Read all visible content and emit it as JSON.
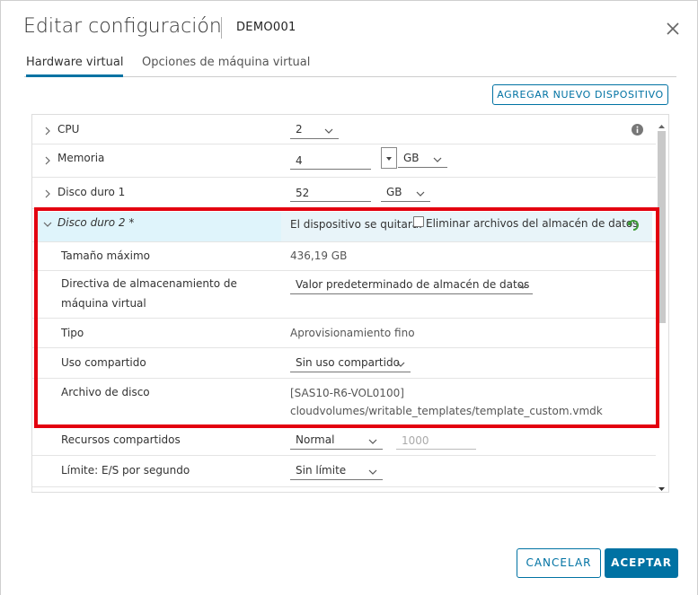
{
  "dialog": {
    "title": "Editar configuración",
    "vm_name": "DEMO001"
  },
  "tabs": [
    {
      "label": "Hardware virtual",
      "active": true
    },
    {
      "label": "Opciones de máquina virtual",
      "active": false
    }
  ],
  "add_device_label": "AGREGAR NUEVO DISPOSITIVO",
  "hardware": {
    "cpu": {
      "label": "CPU",
      "value": "2"
    },
    "memory": {
      "label": "Memoria",
      "value": "4",
      "unit": "GB"
    },
    "disk1": {
      "label": "Disco duro 1",
      "value": "52",
      "unit": "GB"
    },
    "disk2": {
      "label": "Disco duro 2 *",
      "remove_notice": "El dispositivo se quitará.",
      "delete_files_label": "Eliminar archivos del almacén de datos",
      "delete_files_checked": false,
      "max_size": {
        "label": "Tamaño máximo",
        "value": "436,19 GB"
      },
      "policy": {
        "label_line1": "Directiva de almacenamiento de",
        "label_line2": "máquina virtual",
        "value": "Valor predeterminado de almacén de datos"
      },
      "type": {
        "label": "Tipo",
        "value": "Aprovisionamiento fino"
      },
      "sharing": {
        "label": "Uso compartido",
        "value": "Sin uso compartido"
      },
      "disk_file": {
        "label": "Archivo de disco",
        "line1": "[SAS10-R6-VOL0100]",
        "line2": "cloudvolumes/writable_templates/template_custom.vmdk"
      }
    },
    "shares": {
      "label": "Recursos compartidos",
      "value": "Normal",
      "amount": "1000"
    },
    "iops": {
      "label": "Límite: E/S por segundo",
      "value": "Sin límite"
    }
  },
  "footer": {
    "cancel_label": "CANCELAR",
    "ok_label": "ACEPTAR"
  },
  "colors": {
    "accent": "#0072a3",
    "highlight_border": "#e3000f",
    "expanded_row_bg": "#dff4fb",
    "undo_icon": "#3c9b35"
  }
}
